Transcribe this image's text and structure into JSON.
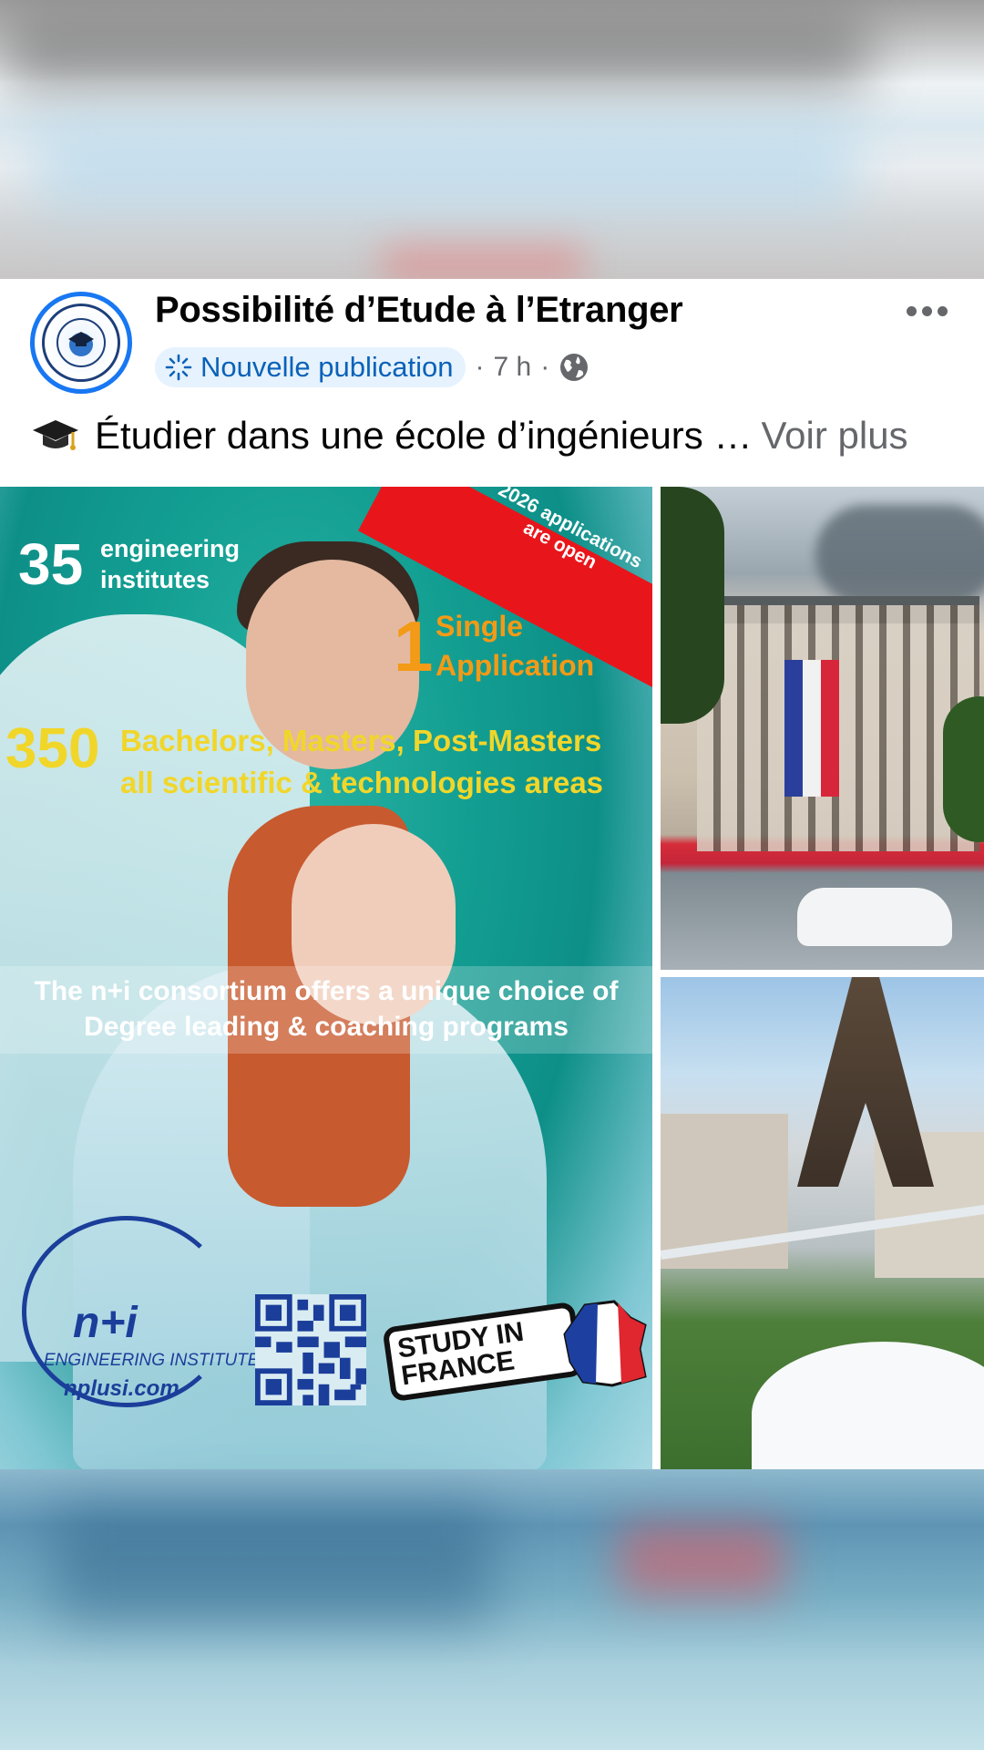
{
  "post": {
    "page_name": "Possibilité d’Etude à l’Etranger",
    "badge_label": "Nouvelle publication",
    "separator": "·",
    "time": "7 h",
    "caption_text": "Étudier dans une école d’ingénieurs …",
    "see_more": "Voir plus"
  },
  "photo_main": {
    "count_35": "35",
    "count_35_label_1": "engineering",
    "count_35_label_2": "institutes",
    "banner_line_1": "2026 applications",
    "banner_line_2": "are open",
    "count_1": "1",
    "count_1_label_1": "Single",
    "count_1_label_2": "Application",
    "count_350": "350",
    "count_350_label_1": "Bachelors, Masters, Post-Masters",
    "count_350_label_2": "all scientific & technologies areas",
    "consortium_line_1": "The n+i consortium offers a unique choice of",
    "consortium_line_2": "Degree leading & coaching programs",
    "logo_ni": "n+i",
    "logo_engineering": "ENGINEERING INSTITUTE",
    "logo_url": "nplusi.com",
    "study_line_1": "STUDY IN",
    "study_line_2": "FRANCE"
  },
  "icons": {
    "avatar": "page-avatar-logo",
    "badge": "sparkle-icon",
    "privacy": "globe-icon",
    "more": "more-options-icon",
    "caption": "graduation-cap-icon"
  },
  "colors": {
    "brand_blue": "#1877f2",
    "badge_bg": "#e6f2fd",
    "badge_text": "#0a62b8",
    "secondary_text": "#65676b",
    "primary_text": "#050505"
  }
}
